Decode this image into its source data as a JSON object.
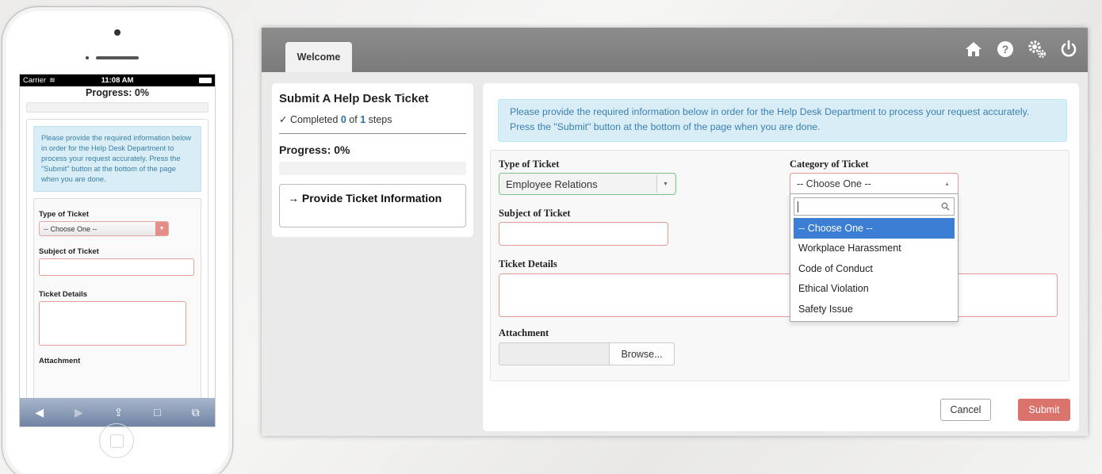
{
  "phone": {
    "status": {
      "carrier": "Carrier",
      "time": "11:08 AM"
    },
    "progress_title": "Progress: 0%",
    "alert": "Please provide the required information below in order for the Help Desk Department to process your request accurately. Press the \"Submit\" button at the bottom of the page when you are done.",
    "type_label": "Type of Ticket",
    "type_value": "-- Choose One --",
    "subject_label": "Subject of Ticket",
    "details_label": "Ticket Details",
    "attachment_label": "Attachment"
  },
  "app": {
    "tab_label": "Welcome",
    "icons": [
      "home-icon",
      "help-icon",
      "settings-icon",
      "power-icon"
    ],
    "sidebar": {
      "title": "Submit A Help Desk Ticket",
      "steps_prefix": "✓ Completed ",
      "steps_done": "0",
      "steps_of": " of ",
      "steps_total": "1",
      "steps_suffix": " steps",
      "progress_label": "Progress: 0%",
      "progress_value": 0,
      "current_step": "→  Provide Ticket Information"
    },
    "form": {
      "alert": "Please provide the required information below in order for the Help Desk Department to process your request accurately. Press the \"Submit\" button at the bottom of the page when you are done.",
      "type_label": "Type of Ticket",
      "type_value": "Employee Relations",
      "category_label": "Category of Ticket",
      "category_value": "-- Choose One --",
      "subject_label": "Subject of Ticket",
      "details_label": "Ticket Details",
      "attachment_label": "Attachment",
      "browse_label": "Browse...",
      "dropdown_options": [
        "-- Choose One --",
        "Workplace Harassment",
        "Code of Conduct",
        "Ethical Violation",
        "Safety Issue"
      ],
      "cancel_label": "Cancel",
      "submit_label": "Submit"
    }
  },
  "colors": {
    "topbar": "#808080",
    "alert_bg": "#d9edf7",
    "alert_text": "#3a7fb1",
    "error_border": "#e29b97",
    "valid_border": "#7cc38b",
    "selected_option": "#3b7ed4",
    "submit_bg": "#d9736c"
  }
}
